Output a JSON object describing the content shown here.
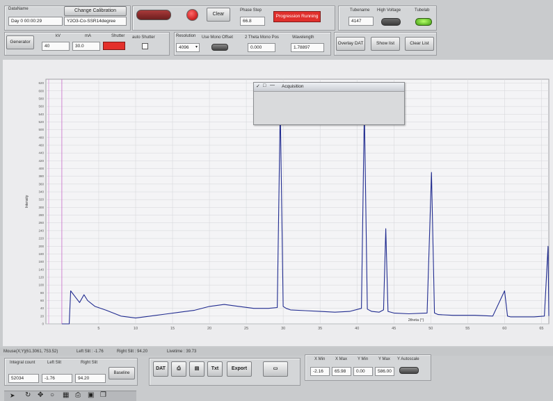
{
  "header": {
    "dataname_label": "DataName",
    "day_value": "Day 0  00:00:29",
    "change_calibration_label": "Change Calibration",
    "sample_name": "Y2O3-Co-SSR14degree",
    "clear_label": "Clear",
    "phase_field_label": "Phase Step",
    "phase_field_value": "66.8",
    "progress_label": "Progression Running",
    "tube_name_label": "Tubename",
    "tube_name_value": "4147",
    "high_voltage_label": "High Voltage",
    "tube_led_label": "Tubelab"
  },
  "generator": {
    "button_label": "Generator",
    "kv_label": "kV",
    "kv_value": "40",
    "ma_label": "mA",
    "ma_value": "30.0",
    "shutter_label": "Shutter",
    "auto_shutter_label": "auto Shutter"
  },
  "resolution": {
    "label": "Resolution",
    "value": "4096",
    "use_mono_label": "Use Mono Offset",
    "theta_label": "2 Theta Mono Pos",
    "theta_value": "0.000",
    "wavelength_label": "Wavelength",
    "wavelength_value": "1.78897"
  },
  "overlay": {
    "overlay_label": "Overlay DAT",
    "show_list_label": "Show list",
    "clear_list_label": "Clear List"
  },
  "acquisition": {
    "title": "Acquisition"
  },
  "chart_data": {
    "type": "line",
    "ylabel": "Intensity",
    "xlabel": "2theta (°)",
    "x_ticks": [
      5,
      10,
      15,
      20,
      25,
      30,
      35,
      40,
      45,
      50,
      55,
      60,
      65
    ],
    "y_ticks": [
      0,
      20,
      40,
      60,
      80,
      100,
      120,
      140,
      160,
      180,
      200,
      220,
      240,
      260,
      280,
      300,
      320,
      340,
      360,
      380,
      400,
      420,
      440,
      460,
      480,
      500,
      520,
      540,
      560,
      580,
      600,
      620
    ],
    "xlim": [
      -2.16,
      66
    ],
    "ylim": [
      0,
      630
    ],
    "series": [
      {
        "color": "#1f2a8f",
        "x": [
          0,
          1.0,
          1.2,
          1.8,
          2.4,
          3.0,
          3.5,
          4.5,
          6,
          8,
          10,
          12,
          14,
          16,
          18,
          20,
          22,
          24,
          26,
          28,
          29.2,
          29.6,
          30.0,
          30.4,
          31,
          33,
          35,
          37,
          39,
          40.6,
          41.0,
          41.4,
          42,
          43,
          43.6,
          43.9,
          44.2,
          45,
          47,
          49.5,
          50.1,
          50.5,
          51.0,
          53,
          56,
          58.4,
          60.0,
          60.4,
          60.8,
          62,
          64,
          65.4,
          65.9,
          66
        ],
        "y": [
          0,
          0,
          85,
          70,
          55,
          75,
          60,
          45,
          35,
          20,
          15,
          20,
          25,
          30,
          35,
          45,
          50,
          45,
          40,
          40,
          42,
          560,
          45,
          40,
          36,
          34,
          32,
          30,
          32,
          40,
          555,
          38,
          32,
          30,
          36,
          245,
          32,
          28,
          26,
          28,
          390,
          28,
          24,
          22,
          22,
          20,
          85,
          20,
          18,
          18,
          18,
          20,
          200,
          20
        ]
      }
    ]
  },
  "status": {
    "mouse_label": "Mouse(X;Y)",
    "mouse_value": "(61.3061, 753.52)",
    "left_slit": "Left Slit : -1.76",
    "right_slit": "Right Slit : 94.20",
    "live_time": "Livetime : 39.73"
  },
  "integration": {
    "integral_label": "Integral count",
    "integral_value": "52034",
    "left_label": "Left Slit",
    "left_value": "-1.76",
    "right_label": "Right Slit",
    "right_value": "94.20",
    "baseline_label": "Baseline"
  },
  "tools": {
    "dat_label": "DAT",
    "txt_label": "Txt",
    "export_label": "Export"
  },
  "axes": {
    "xmin_label": "X Min",
    "xmin_value": "-2.16",
    "xmax_label": "X Max",
    "xmax_value": "65.98",
    "ymin_label": "Y Min",
    "ymin_value": "0.00",
    "ymax_label": "Y Max",
    "ymax_value": "586.00",
    "autoscale_label": "Y Autoscale"
  }
}
